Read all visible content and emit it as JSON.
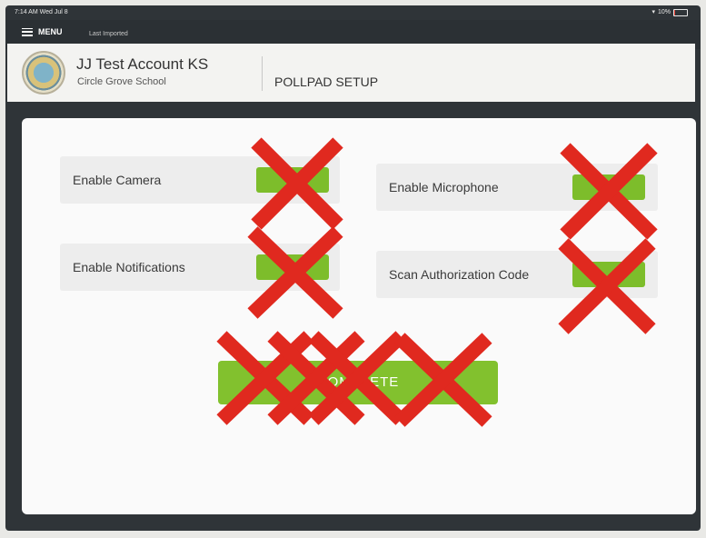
{
  "status_bar": {
    "time": "7:14 AM",
    "date": "Wed Jul 8",
    "battery": "10%",
    "battery_level": 0.1
  },
  "menu_bar": {
    "menu_label": "MENU",
    "last_imported": "Last Imported"
  },
  "header": {
    "account_name": "JJ Test Account KS",
    "school_name": "Circle Grove School",
    "page_title": "POLLPAD SETUP"
  },
  "settings": [
    {
      "label": "Enable Camera",
      "toggle_text": ""
    },
    {
      "label": "Enable Microphone",
      "toggle_text": ""
    },
    {
      "label": "Enable Notifications",
      "toggle_text": ""
    },
    {
      "label": "Scan Authorization Code",
      "toggle_text": ""
    }
  ],
  "complete_button": {
    "label": "COMPLETE"
  },
  "colors": {
    "accent_green": "#82c12e",
    "cross_out_red": "#e0291f",
    "frame_dark": "#2f3438"
  },
  "annotations": {
    "cross_out_marks": 8
  }
}
